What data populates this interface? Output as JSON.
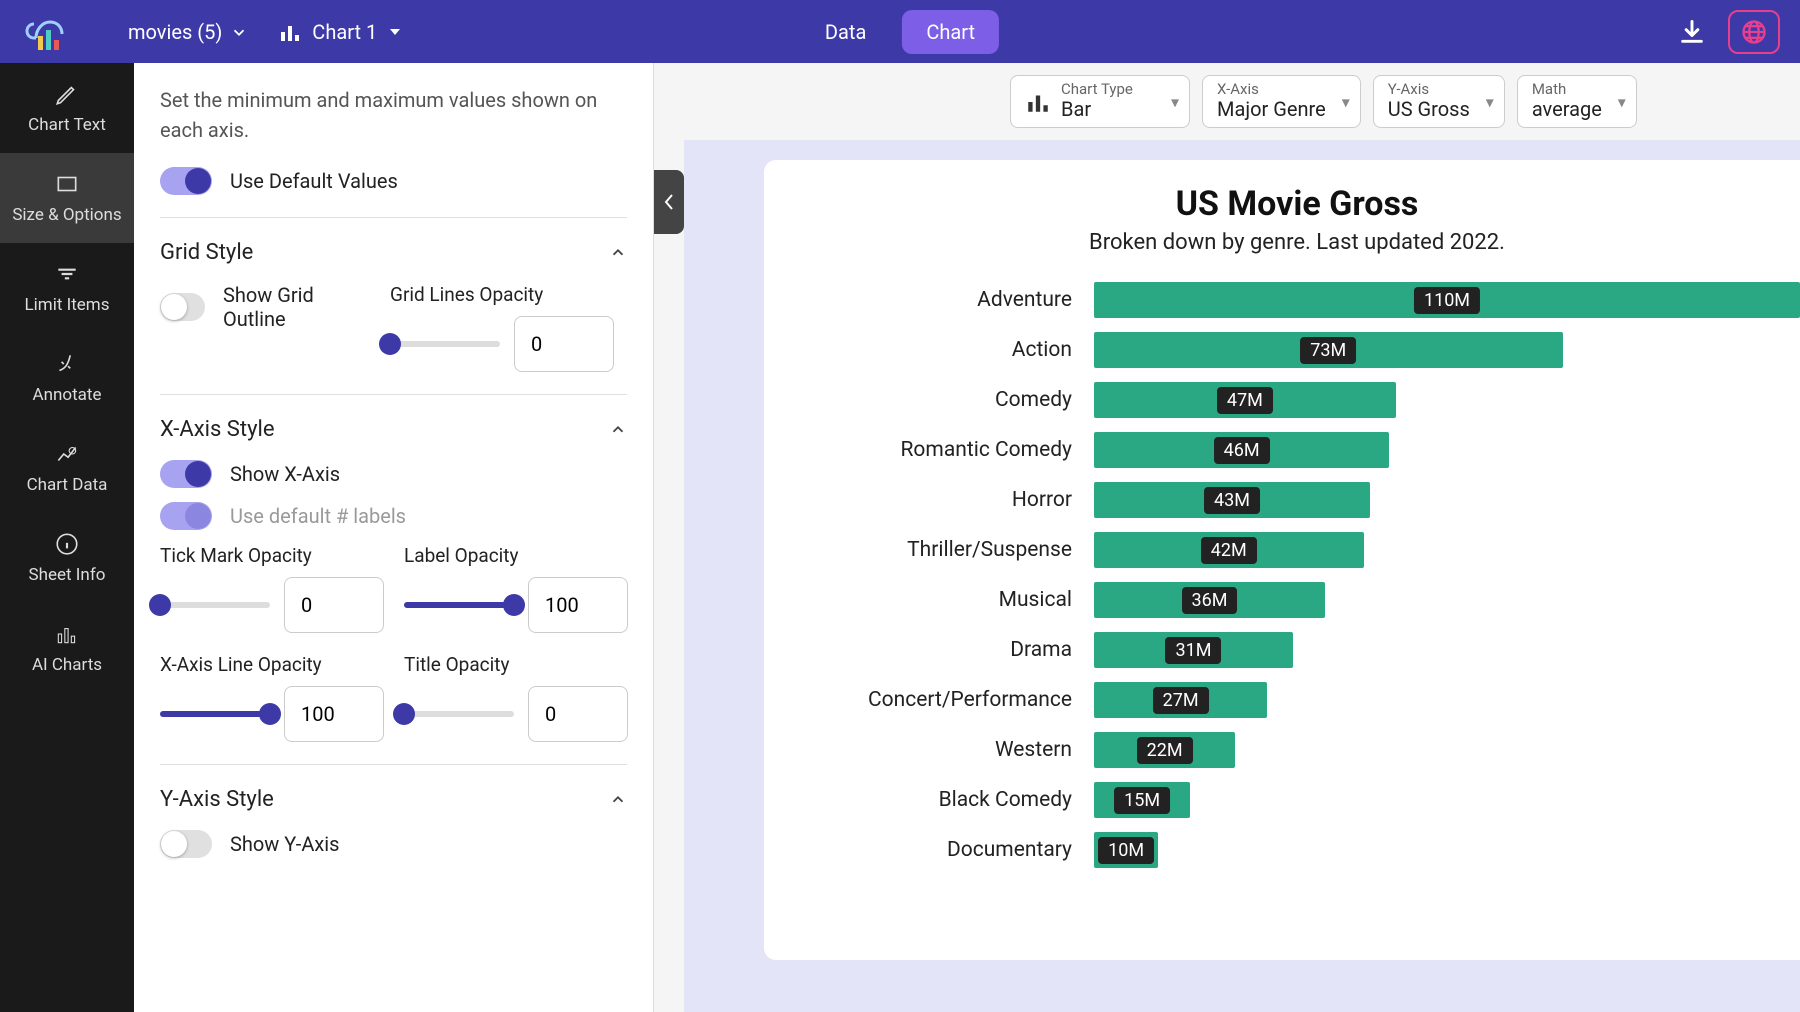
{
  "topbar": {
    "dataset_label": "movies (5)",
    "chart_label": "Chart 1",
    "tab_data": "Data",
    "tab_chart": "Chart"
  },
  "leftnav": {
    "chart_text": "Chart Text",
    "size_options": "Size & Options",
    "limit_items": "Limit Items",
    "annotate": "Annotate",
    "chart_data": "Chart Data",
    "sheet_info": "Sheet Info",
    "ai_charts": "AI Charts"
  },
  "panel": {
    "description": "Set the minimum and maximum values shown on each axis.",
    "use_default_values": "Use Default Values",
    "grid_style": "Grid Style",
    "show_grid_outline": "Show Grid Outline",
    "grid_lines_opacity": "Grid Lines Opacity",
    "grid_lines_value": "0",
    "x_axis_style": "X-Axis Style",
    "show_x_axis": "Show X-Axis",
    "use_default_labels": "Use default # labels",
    "tick_mark_opacity": "Tick Mark Opacity",
    "tick_mark_value": "0",
    "label_opacity": "Label Opacity",
    "label_opacity_value": "100",
    "x_line_opacity": "X-Axis Line Opacity",
    "x_line_value": "100",
    "title_opacity": "Title Opacity",
    "title_opacity_value": "0",
    "y_axis_style": "Y-Axis Style",
    "show_y_axis": "Show Y-Axis"
  },
  "config": {
    "chart_type_label": "Chart Type",
    "chart_type_value": "Bar",
    "x_axis_label": "X-Axis",
    "x_axis_value": "Major Genre",
    "y_axis_label": "Y-Axis",
    "y_axis_value": "US Gross",
    "math_label": "Math",
    "math_value": "average"
  },
  "chart": {
    "title": "US Movie Gross",
    "subtitle": "Broken down by genre. Last updated 2022."
  },
  "chart_data": {
    "type": "bar",
    "orientation": "horizontal",
    "title": "US Movie Gross",
    "subtitle": "Broken down by genre. Last updated 2022.",
    "xlabel": "",
    "ylabel": "",
    "categories": [
      "Adventure",
      "Action",
      "Comedy",
      "Romantic Comedy",
      "Horror",
      "Thriller/Suspense",
      "Musical",
      "Drama",
      "Concert/Performance",
      "Western",
      "Black Comedy",
      "Documentary"
    ],
    "values": [
      110,
      73,
      47,
      46,
      43,
      42,
      36,
      31,
      27,
      22,
      15,
      10
    ],
    "value_labels": [
      "110M",
      "73M",
      "47M",
      "46M",
      "43M",
      "42M",
      "36M",
      "31M",
      "27M",
      "22M",
      "15M",
      "10M"
    ],
    "unit": "M",
    "xlim": [
      0,
      110
    ],
    "bar_color": "#2aa884"
  }
}
